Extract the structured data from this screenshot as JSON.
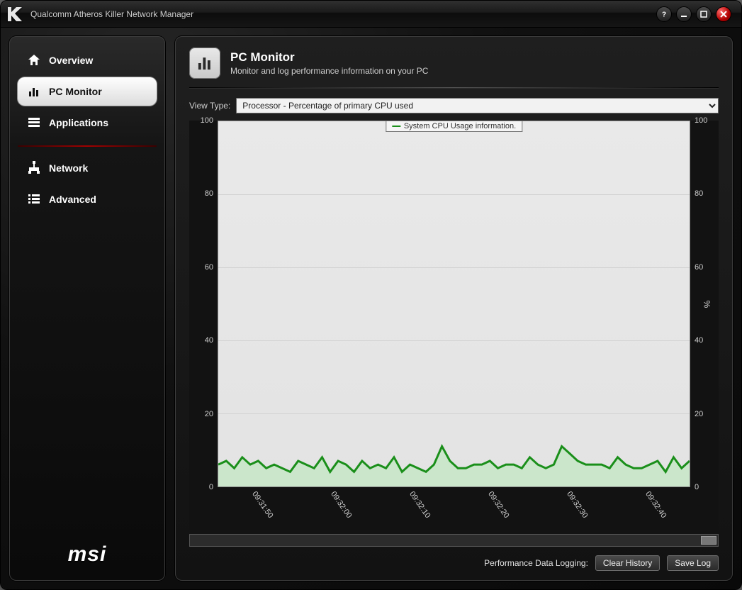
{
  "titlebar": {
    "title": "Qualcomm Atheros Killer Network Manager"
  },
  "sidebar": {
    "items": [
      {
        "label": "Overview"
      },
      {
        "label": "PC Monitor"
      },
      {
        "label": "Applications"
      },
      {
        "label": "Network"
      },
      {
        "label": "Advanced"
      }
    ],
    "brand": "msi"
  },
  "page": {
    "title": "PC Monitor",
    "subtitle": "Monitor and log performance information on your PC",
    "view_type_label": "View Type:",
    "view_type_value": "Processor - Percentage of primary CPU used"
  },
  "footer": {
    "logging_label": "Performance Data Logging:",
    "clear_button": "Clear History",
    "save_button": "Save Log"
  },
  "chart_data": {
    "type": "line",
    "title": "",
    "legend": "System CPU Usage information.",
    "ylabel": "%",
    "ylim": [
      0,
      100
    ],
    "yticks": [
      0,
      20,
      40,
      60,
      80,
      100
    ],
    "categories": [
      "09:31:50",
      "09:32:00",
      "09:32:10",
      "09:32:20",
      "09:32:30",
      "09:32:40"
    ],
    "series": [
      {
        "name": "System CPU Usage information.",
        "color": "#1a8f1a",
        "values": [
          6,
          7,
          5,
          8,
          6,
          7,
          5,
          6,
          5,
          4,
          7,
          6,
          5,
          8,
          4,
          7,
          6,
          4,
          7,
          5,
          6,
          5,
          8,
          4,
          6,
          5,
          4,
          6,
          11,
          7,
          5,
          5,
          6,
          6,
          7,
          5,
          6,
          6,
          5,
          8,
          6,
          5,
          6,
          11,
          9,
          7,
          6,
          6,
          6,
          5,
          8,
          6,
          5,
          5,
          6,
          7,
          4,
          8,
          5,
          7
        ]
      }
    ]
  }
}
